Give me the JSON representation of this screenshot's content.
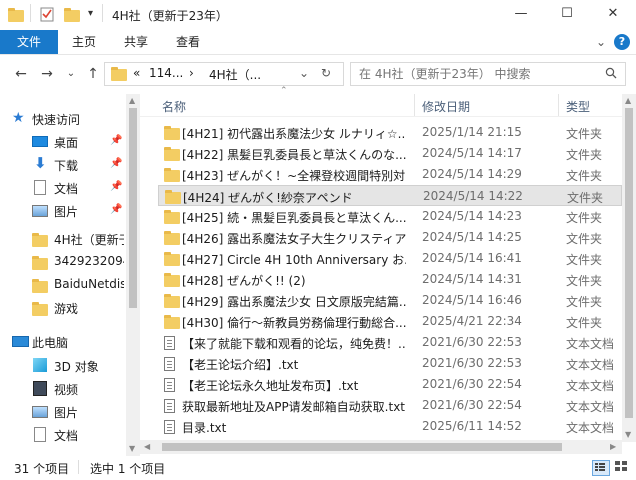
{
  "window": {
    "title": "4H社（更新于23年）",
    "min_glyph": "—",
    "max_glyph": "☐",
    "close_glyph": "✕"
  },
  "ribbon": {
    "tabs": [
      "文件",
      "主页",
      "共享",
      "查看"
    ],
    "help": "?",
    "expand": "⌄"
  },
  "address": {
    "crumbs": [
      "«",
      "114...",
      "›",
      "4H社（...",
      "⌄"
    ],
    "refresh": "↻"
  },
  "search": {
    "placeholder": "在 4H社（更新于23年） 中搜索"
  },
  "sidebar": {
    "quick_access": "快速访问",
    "items": [
      {
        "label": "桌面",
        "icon": "desktop-icon",
        "pinned": true
      },
      {
        "label": "下载",
        "icon": "download-icon",
        "pinned": true
      },
      {
        "label": "文档",
        "icon": "documents-icon",
        "pinned": true
      },
      {
        "label": "图片",
        "icon": "pictures-icon",
        "pinned": true
      },
      {
        "label": "4H社（更新于",
        "icon": "folder-icon",
        "pinned": false
      },
      {
        "label": "3429232094",
        "icon": "folder-icon",
        "pinned": false
      },
      {
        "label": "BaiduNetdis",
        "icon": "folder-icon",
        "pinned": false
      },
      {
        "label": "游戏",
        "icon": "folder-icon",
        "pinned": false
      }
    ],
    "this_pc": "此电脑",
    "pc_items": [
      {
        "label": "3D 对象",
        "icon": "3d-objects-icon"
      },
      {
        "label": "视频",
        "icon": "videos-icon"
      },
      {
        "label": "图片",
        "icon": "pictures-icon"
      },
      {
        "label": "文档",
        "icon": "documents-icon"
      }
    ]
  },
  "columns": {
    "name": "名称",
    "date": "修改日期",
    "type": "类型"
  },
  "files": [
    {
      "name": "[4H21] 初代露出系魔法少女 ルナリィ☆...",
      "date": "2025/1/14 21:15",
      "type": "文件夹",
      "icon": "folder-icon",
      "selected": false
    },
    {
      "name": "[4H22] 黒髪巨乳委員長と草汰くんのな...",
      "date": "2024/5/14 14:17",
      "type": "文件夹",
      "icon": "folder-icon",
      "selected": false
    },
    {
      "name": "[4H23] ぜんがく！~全裸登校週間特別対...",
      "date": "2024/5/14 14:29",
      "type": "文件夹",
      "icon": "folder-icon",
      "selected": false
    },
    {
      "name": "[4H24] ぜんがく!紗奈アペンド",
      "date": "2024/5/14 14:22",
      "type": "文件夹",
      "icon": "folder-icon",
      "selected": true
    },
    {
      "name": "[4H25] 続・黒髪巨乳委員長と草汰くん...",
      "date": "2024/5/14 14:23",
      "type": "文件夹",
      "icon": "folder-icon",
      "selected": false
    },
    {
      "name": "[4H26] 露出系魔法女子大生クリスティア",
      "date": "2024/5/14 14:25",
      "type": "文件夹",
      "icon": "folder-icon",
      "selected": false
    },
    {
      "name": "[4H27] Circle 4H 10th Anniversary お...",
      "date": "2024/5/14 16:41",
      "type": "文件夹",
      "icon": "folder-icon",
      "selected": false
    },
    {
      "name": "[4H28] ぜんがく!! (2)",
      "date": "2024/5/14 14:31",
      "type": "文件夹",
      "icon": "folder-icon",
      "selected": false
    },
    {
      "name": "[4H29] 露出系魔法少女 日文原版完結篇...",
      "date": "2024/5/14 16:46",
      "type": "文件夹",
      "icon": "folder-icon",
      "selected": false
    },
    {
      "name": "[4H30] 倫行～新教員労務倫理行動総合...",
      "date": "2025/4/21 22:34",
      "type": "文件夹",
      "icon": "folder-icon",
      "selected": false
    },
    {
      "name": "【来了就能下载和观看的论坛，纯免费！...",
      "date": "2021/6/30 22:53",
      "type": "文本文档",
      "icon": "text-file-icon",
      "selected": false
    },
    {
      "name": "【老王论坛介绍】.txt",
      "date": "2021/6/30 22:53",
      "type": "文本文档",
      "icon": "text-file-icon",
      "selected": false
    },
    {
      "name": "【老王论坛永久地址发布页】.txt",
      "date": "2021/6/30 22:54",
      "type": "文本文档",
      "icon": "text-file-icon",
      "selected": false
    },
    {
      "name": "获取最新地址及APP请发邮箱自动获取.txt",
      "date": "2021/6/30 22:54",
      "type": "文本文档",
      "icon": "text-file-icon",
      "selected": false
    },
    {
      "name": "目录.txt",
      "date": "2025/6/11 14:52",
      "type": "文本文档",
      "icon": "text-file-icon",
      "selected": false
    }
  ],
  "status": {
    "count": "31 个项目",
    "selected": "选中 1 个项目"
  }
}
